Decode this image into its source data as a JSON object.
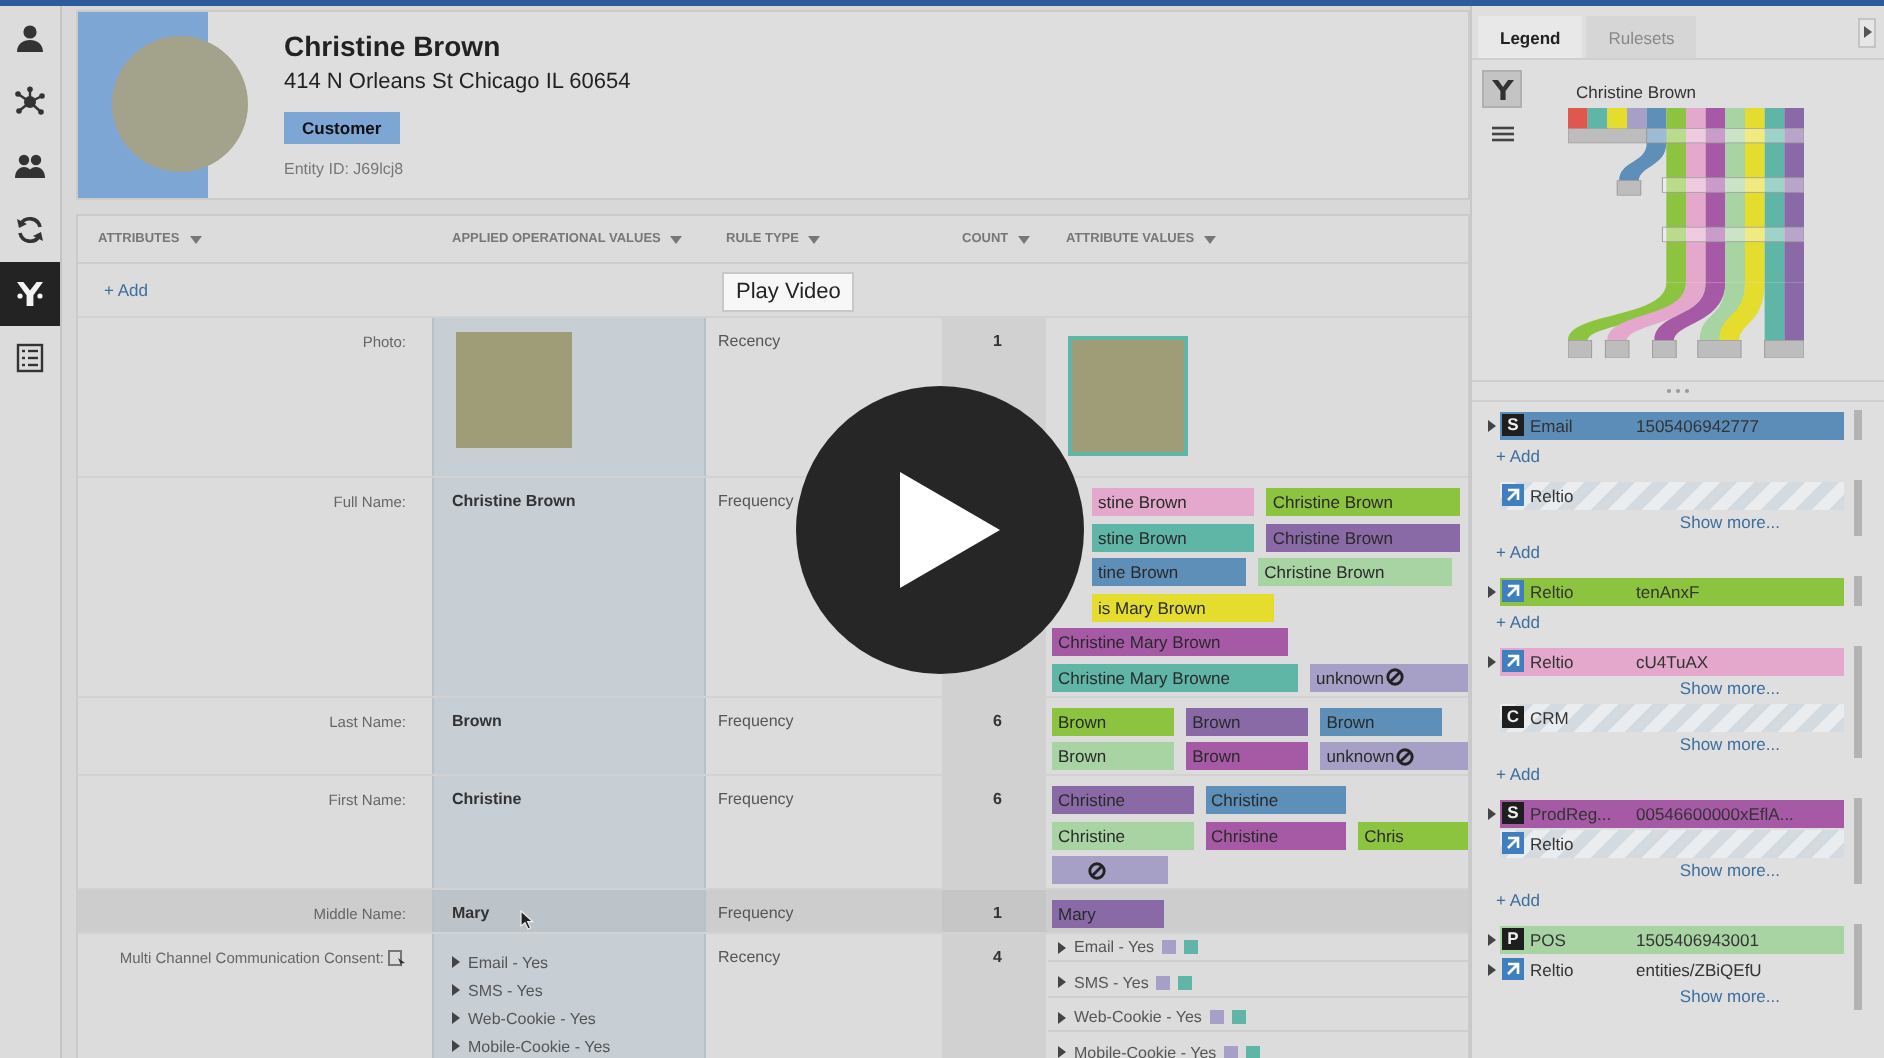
{
  "sidebar": {
    "items": [
      {
        "kind": "person",
        "selected": false
      },
      {
        "kind": "hub",
        "selected": false
      },
      {
        "kind": "people",
        "selected": false
      },
      {
        "kind": "refresh",
        "selected": false
      },
      {
        "kind": "tree",
        "selected": true
      },
      {
        "kind": "list",
        "selected": false
      }
    ]
  },
  "profile": {
    "name": "Christine Brown",
    "address": "414 N Orleans St Chicago IL 60654",
    "badge": "Customer",
    "entity_id": "Entity ID: J69lcj8"
  },
  "table": {
    "columns": [
      {
        "label": "ATTRIBUTES"
      },
      {
        "label": "APPLIED OPERATIONAL VALUES"
      },
      {
        "label": "RULE TYPE"
      },
      {
        "label": "COUNT"
      },
      {
        "label": "ATTRIBUTE VALUES"
      }
    ],
    "add": "+ Add",
    "rows": [
      {
        "kind": "photo",
        "attribute": "Photo:",
        "rule": "Recency",
        "count": "1",
        "highlighted": false
      },
      {
        "kind": "tags",
        "attribute": "Full Name:",
        "applied": "Christine Brown",
        "rule": "Frequency",
        "highlighted": false,
        "value_lines": [
          [
            {
              "text": "stine Brown",
              "color": "#e3a8cc",
              "covered": true
            },
            {
              "text": "Christine Brown",
              "color": "#8dc43f"
            }
          ],
          [
            {
              "text": "stine Brown",
              "color": "#5fb5a6",
              "covered": true
            },
            {
              "text": "Christine Brown",
              "color": "#8a6aa6"
            }
          ],
          [
            {
              "text": "tine Brown",
              "color": "#5d8fb8",
              "covered": true
            },
            {
              "text": "Christine Brown",
              "color": "#a8d3a3"
            }
          ],
          [
            {
              "text": "is Mary Brown",
              "color": "#e4dd2e",
              "covered": true
            }
          ],
          [
            {
              "text": "Christine Mary Brown",
              "color": "#a65aa5"
            }
          ],
          [
            {
              "text": "Christine Mary Browne",
              "color": "#5fb5a6"
            },
            {
              "text": "unknown",
              "color": "#a6a0c6",
              "blocked": true
            }
          ]
        ]
      },
      {
        "kind": "tags",
        "attribute": "Last Name:",
        "applied": "Brown",
        "rule": "Frequency",
        "count": "6",
        "highlighted": false,
        "value_lines": [
          [
            {
              "text": "Brown",
              "color": "#8dc43f"
            },
            {
              "text": "Brown",
              "color": "#8a6aa6"
            },
            {
              "text": "Brown",
              "color": "#5d8fb8"
            }
          ],
          [
            {
              "text": "Brown",
              "color": "#a8d3a3"
            },
            {
              "text": "Brown",
              "color": "#a65aa5"
            },
            {
              "text": "unknown",
              "color": "#a6a0c6",
              "blocked": true
            }
          ]
        ]
      },
      {
        "kind": "tags",
        "attribute": "First Name:",
        "applied": "Christine",
        "rule": "Frequency",
        "count": "6",
        "highlighted": false,
        "value_lines": [
          [
            {
              "text": "Christine",
              "color": "#8a6aa6"
            },
            {
              "text": "Christine",
              "color": "#5d8fb8"
            }
          ],
          [
            {
              "text": "Christine",
              "color": "#a8d3a3"
            },
            {
              "text": "Christine",
              "color": "#a65aa5"
            },
            {
              "text": "Chris",
              "color": "#8dc43f"
            }
          ],
          [
            {
              "color": "#a6a0c6",
              "blocked": true
            }
          ]
        ]
      },
      {
        "kind": "tags",
        "attribute": "Middle Name:",
        "applied": "Mary",
        "rule": "Frequency",
        "count": "1",
        "highlighted": true,
        "value_lines": [
          [
            {
              "text": "Mary",
              "color": "#8a6aa6"
            }
          ]
        ]
      },
      {
        "kind": "consent",
        "attribute": "Multi Channel Communication Consent:",
        "rule": "Recency",
        "count": "4",
        "highlighted": false,
        "applied_items": [
          {
            "text": "Email - Yes",
            "expanded": false
          },
          {
            "text": "SMS - Yes",
            "expanded": false
          },
          {
            "text": "Web-Cookie - Yes",
            "expanded": false
          },
          {
            "text": "Mobile-Cookie - Yes",
            "expanded": false
          }
        ],
        "value_items": [
          {
            "text": "Email - Yes",
            "expanded": false,
            "swatches": [
              {
                "color": "#a6a0c6"
              },
              {
                "color": "#5fb5a6"
              }
            ]
          },
          {
            "text": "SMS - Yes",
            "expanded": false,
            "swatches": [
              {
                "color": "#a6a0c6"
              },
              {
                "color": "#5fb5a6"
              }
            ]
          },
          {
            "text": "Web-Cookie - Yes",
            "expanded": false,
            "swatches": [
              {
                "color": "#a6a0c6"
              },
              {
                "color": "#5fb5a6"
              }
            ]
          },
          {
            "text": "Mobile-Cookie - Yes",
            "expanded": false,
            "swatches": [
              {
                "color": "#a6a0c6"
              },
              {
                "color": "#5fb5a6"
              }
            ]
          }
        ]
      }
    ]
  },
  "legend": {
    "tabs": [
      {
        "label": "Legend",
        "selected": true
      },
      {
        "label": "Rulesets",
        "selected": false
      }
    ],
    "tools": [
      {
        "kind": "filter",
        "selected": true
      },
      {
        "kind": "list",
        "selected": false
      }
    ],
    "chart_title": "Christine Brown",
    "groups": [
      {
        "lines": [
          {
            "kind": "record",
            "badge": "S",
            "source": "Email",
            "value": "1505406942777",
            "color": "#5b8db8",
            "expanded": false
          }
        ],
        "add": "+ Add"
      },
      {
        "lines": [
          {
            "kind": "record",
            "source": "Reltio",
            "hatched": true
          },
          {
            "kind": "show_more",
            "text": "Show more..."
          }
        ],
        "add": "+ Add"
      },
      {
        "lines": [
          {
            "kind": "record",
            "source": "Reltio",
            "value": "tenAnxF",
            "color": "#8dc43f",
            "expanded": false
          }
        ],
        "add": "+ Add"
      },
      {
        "lines": [
          {
            "kind": "record",
            "source": "Reltio",
            "value": "cU4TuAX",
            "color": "#e3a8cc",
            "expanded": false
          },
          {
            "kind": "show_more",
            "text": "Show more..."
          },
          {
            "kind": "record",
            "badge": "C",
            "source": "CRM",
            "hatched": true
          },
          {
            "kind": "show_more",
            "text": "Show more..."
          }
        ],
        "add": "+ Add"
      },
      {
        "lines": [
          {
            "kind": "record",
            "badge": "S",
            "source": "ProdReg...",
            "value": "00546600000xEflA...",
            "color": "#a65aa5",
            "expanded": false
          },
          {
            "kind": "record",
            "source": "Reltio",
            "hatched": true
          },
          {
            "kind": "show_more",
            "text": "Show more..."
          }
        ],
        "add": "+ Add"
      },
      {
        "lines": [
          {
            "kind": "record",
            "badge": "P",
            "source": "POS",
            "value": "1505406943001",
            "color": "#a8d3a3",
            "expanded": false
          },
          {
            "kind": "record",
            "source": "Reltio",
            "value": "entities/ZBiQEfU",
            "hatched": false,
            "expanded": false
          },
          {
            "kind": "show_more",
            "text": "Show more..."
          }
        ]
      }
    ]
  },
  "video": {
    "tooltip": "Play Video"
  }
}
